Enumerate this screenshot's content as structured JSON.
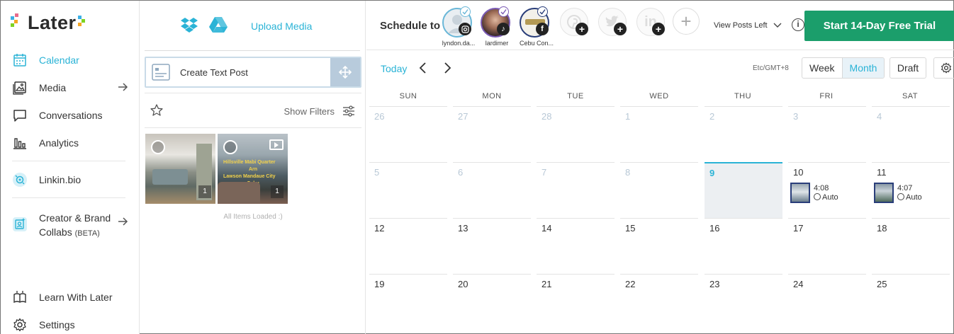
{
  "app": {
    "logo_text": "Later"
  },
  "sidebar": {
    "items": [
      {
        "label": "Calendar",
        "icon": "calendar-icon"
      },
      {
        "label": "Media",
        "icon": "image-icon"
      },
      {
        "label": "Conversations",
        "icon": "chat-icon"
      },
      {
        "label": "Analytics",
        "icon": "bar-chart-icon"
      },
      {
        "label": "Linkin.bio",
        "icon": "link-bio-icon"
      },
      {
        "label": "Creator & Brand",
        "label2": "Collabs",
        "badge": "(BETA)",
        "icon": "collabs-icon"
      },
      {
        "label": "Learn With Later",
        "icon": "book-icon"
      },
      {
        "label": "Settings",
        "icon": "gear-icon"
      }
    ]
  },
  "media": {
    "upload_label": "Upload Media",
    "create_text_post": "Create Text Post",
    "show_filters": "Show Filters",
    "items": [
      {
        "count": "1",
        "type": "image"
      },
      {
        "count": "1",
        "type": "video",
        "overlay": [
          "Hillsville Mabi Quarter",
          "Arn",
          "Lawson Mandaue City",
          "Cebu"
        ]
      }
    ],
    "loaded_text": "All Items Loaded :)"
  },
  "topbar": {
    "schedule_to": "Schedule to",
    "accounts": [
      {
        "name": "lyndon.da...",
        "network": "instagram"
      },
      {
        "name": "lardimer",
        "network": "tiktok"
      },
      {
        "name": "Cebu Con...",
        "network": "facebook"
      }
    ],
    "view_posts_left": "View Posts Left",
    "trial_button": "Start 14-Day Free Trial"
  },
  "calendar": {
    "today_label": "Today",
    "timezone": "Etc/GMT+8",
    "view_week": "Week",
    "view_month": "Month",
    "draft": "Draft",
    "days": [
      "SUN",
      "MON",
      "TUE",
      "WED",
      "THU",
      "FRI",
      "SAT"
    ],
    "weeks": [
      [
        "26",
        "27",
        "28",
        "1",
        "2",
        "3",
        "4"
      ],
      [
        "5",
        "6",
        "7",
        "8",
        "9",
        "10",
        "11"
      ],
      [
        "12",
        "13",
        "14",
        "15",
        "16",
        "17",
        "18"
      ],
      [
        "19",
        "20",
        "21",
        "22",
        "23",
        "24",
        "25"
      ]
    ],
    "posts": {
      "fri": {
        "time": "4:08",
        "mode": "Auto"
      },
      "sat": {
        "time": "4:07",
        "mode": "Auto"
      }
    }
  },
  "colors": {
    "accent": "#2ab3d6",
    "trial": "#1b9e6b"
  }
}
